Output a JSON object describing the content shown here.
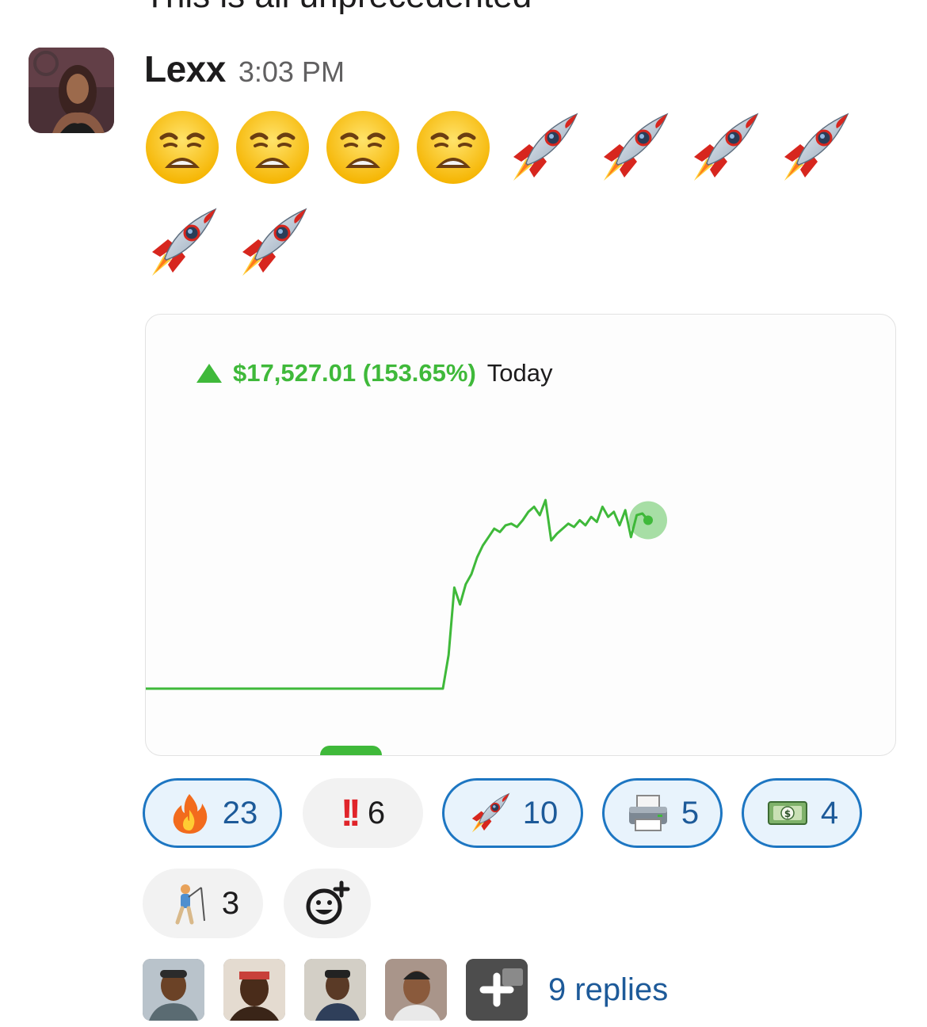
{
  "previous_message": {
    "text": "This is all unprecedented"
  },
  "message": {
    "author": "Lexx",
    "time": "3:03 PM",
    "avatar_icon": "user-avatar",
    "emojis_row1": [
      "weary-face-icon",
      "weary-face-icon",
      "weary-face-icon",
      "weary-face-icon",
      "rocket-icon",
      "rocket-icon",
      "rocket-icon",
      "rocket-icon"
    ],
    "emojis_row2": [
      "rocket-icon",
      "rocket-icon"
    ]
  },
  "attachment": {
    "gain": "$17,527.01 (153.65%)",
    "period": "Today",
    "colors": {
      "gain": "#3fb93a"
    },
    "chart_data": {
      "type": "line",
      "title": "",
      "xlabel": "",
      "ylabel": "",
      "grid": false,
      "legend": "none",
      "series": [
        {
          "values": [
            0,
            0,
            0,
            0,
            0,
            0,
            0,
            0,
            0,
            0,
            0,
            0,
            0,
            0,
            0.2,
            0.6,
            0.5,
            0.62,
            0.68,
            0.78,
            0.85,
            0.9,
            0.95,
            0.93,
            0.97,
            0.98,
            0.96,
            1.0,
            1.05,
            1.08,
            1.03,
            1.12,
            0.88,
            0.92,
            0.95,
            0.98,
            0.96,
            1.0,
            0.97,
            1.02,
            0.99,
            1.08,
            1.02,
            1.05,
            0.97,
            1.06,
            0.9,
            1.03,
            1.04,
            1.0
          ]
        }
      ]
    }
  },
  "reactions": [
    {
      "emoji": "fire-icon",
      "count": "23",
      "active": true
    },
    {
      "emoji": "double-exclamation-icon",
      "label": "!!",
      "count": "6",
      "active": false
    },
    {
      "emoji": "rocket-icon",
      "count": "10",
      "active": true
    },
    {
      "emoji": "printer-icon",
      "count": "5",
      "active": true
    },
    {
      "emoji": "dollar-banknote-icon",
      "count": "4",
      "active": true
    },
    {
      "emoji": "person-golfing-icon",
      "count": "3",
      "active": false
    }
  ],
  "add_reaction_icon": "add-reaction-icon",
  "thread": {
    "replies_label": "9 replies",
    "participant_icons": [
      "participant-avatar",
      "participant-avatar",
      "participant-avatar",
      "participant-avatar",
      "more-participants-icon"
    ]
  }
}
